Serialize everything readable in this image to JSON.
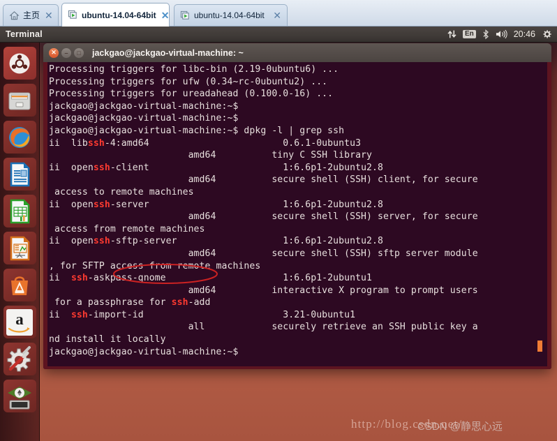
{
  "tabs": [
    {
      "label": "主页",
      "icon": "home-icon",
      "closable": true,
      "active": false
    },
    {
      "label": "ubuntu-14.04-64bit",
      "icon": "virtual-machine-icon",
      "closable": true,
      "active": true
    },
    {
      "label": "ubuntu-14.04-64bit",
      "icon": "virtual-machine-icon",
      "closable": true,
      "active": false
    }
  ],
  "tab_close_glyph": "✕",
  "panel": {
    "title": "Terminal",
    "tray": {
      "network_icon": "network-up-down-icon",
      "keyboard_layout": "En",
      "bluetooth_icon": "bluetooth-icon",
      "volume_icon": "volume-icon",
      "clock": "20:46",
      "session_icon": "gear-icon"
    }
  },
  "launcher": {
    "items": [
      {
        "name": "dash-home",
        "icon": "ubuntu-logo-icon"
      },
      {
        "name": "files",
        "icon": "file-manager-icon"
      },
      {
        "name": "firefox",
        "icon": "firefox-icon"
      },
      {
        "name": "libreoffice-writer",
        "icon": "document-icon"
      },
      {
        "name": "libreoffice-calc",
        "icon": "spreadsheet-icon"
      },
      {
        "name": "libreoffice-impress",
        "icon": "presentation-icon"
      },
      {
        "name": "ubuntu-software-center",
        "icon": "shopping-bag-icon"
      },
      {
        "name": "amazon",
        "icon": "amazon-icon"
      },
      {
        "name": "system-settings",
        "icon": "gear-wrench-icon"
      },
      {
        "name": "workspace-switcher",
        "icon": "workspace-icon"
      }
    ]
  },
  "terminal": {
    "title": "jackgao@jackgao-virtual-machine: ~",
    "window_buttons": {
      "close": "✕",
      "minimize": "–",
      "maximize": "□"
    },
    "prompt": "jackgao@jackgao-virtual-machine:~$",
    "command": "dpkg -l | grep ssh",
    "match_token": "ssh",
    "lines": [
      "Processing triggers for libc-bin (2.19-0ubuntu6) ...",
      "Processing triggers for ufw (0.34~rc-0ubuntu2) ...",
      "Processing triggers for ureadahead (0.100.0-16) ...",
      "jackgao@jackgao-virtual-machine:~$ ",
      "jackgao@jackgao-virtual-machine:~$ ",
      "jackgao@jackgao-virtual-machine:~$ dpkg -l | grep ssh",
      "ii  libssh-4:amd64                        0.6.1-0ubuntu3",
      "                         amd64          tiny C SSH library",
      "ii  openssh-client                        1:6.6p1-2ubuntu2.8",
      "                         amd64          secure shell (SSH) client, for secure",
      " access to remote machines",
      "ii  openssh-server                        1:6.6p1-2ubuntu2.8",
      "                         amd64          secure shell (SSH) server, for secure",
      " access from remote machines",
      "ii  openssh-sftp-server                   1:6.6p1-2ubuntu2.8",
      "                         amd64          secure shell (SSH) sftp server module",
      ", for SFTP access from remote machines",
      "ii  ssh-askpass-gnome                     1:6.6p1-2ubuntu1",
      "                         amd64          interactive X program to prompt users",
      " for a passphrase for ssh-add",
      "ii  ssh-import-id                         3.21-0ubuntu1",
      "                         all            securely retrieve an SSH public key a",
      "nd install it locally",
      "jackgao@jackgao-virtual-machine:~$ "
    ],
    "packages": [
      {
        "status": "ii",
        "name": "libssh-4:amd64",
        "version": "0.6.1-0ubuntu3",
        "arch": "amd64",
        "description": "tiny C SSH library"
      },
      {
        "status": "ii",
        "name": "openssh-client",
        "version": "1:6.6p1-2ubuntu2.8",
        "arch": "amd64",
        "description": "secure shell (SSH) client, for secure access to remote machines"
      },
      {
        "status": "ii",
        "name": "openssh-server",
        "version": "1:6.6p1-2ubuntu2.8",
        "arch": "amd64",
        "description": "secure shell (SSH) server, for secure access from remote machines",
        "annotated": true
      },
      {
        "status": "ii",
        "name": "openssh-sftp-server",
        "version": "1:6.6p1-2ubuntu2.8",
        "arch": "amd64",
        "description": "secure shell (SSH) sftp server module, for SFTP access from remote machines"
      },
      {
        "status": "ii",
        "name": "ssh-askpass-gnome",
        "version": "1:6.6p1-2ubuntu1",
        "arch": "amd64",
        "description": "interactive X program to prompt users for a passphrase for ssh-add"
      },
      {
        "status": "ii",
        "name": "ssh-import-id",
        "version": "3.21-0ubuntu1",
        "arch": "all",
        "description": "securely retrieve an SSH public key and install it locally"
      }
    ]
  },
  "annotation": {
    "type": "ellipse",
    "target": "openssh-server",
    "color": "#cc2222"
  },
  "watermarks": {
    "url": "http://blog.csdn.net/",
    "author": "CSDN @静思心远"
  },
  "colors": {
    "terminal_bg": "#2d0922",
    "terminal_border": "#5d1420",
    "grep_match": "#ff3a30",
    "cursor": "#f07c35",
    "panel_bg": "#3b3633",
    "desktop": "#a8543f"
  }
}
